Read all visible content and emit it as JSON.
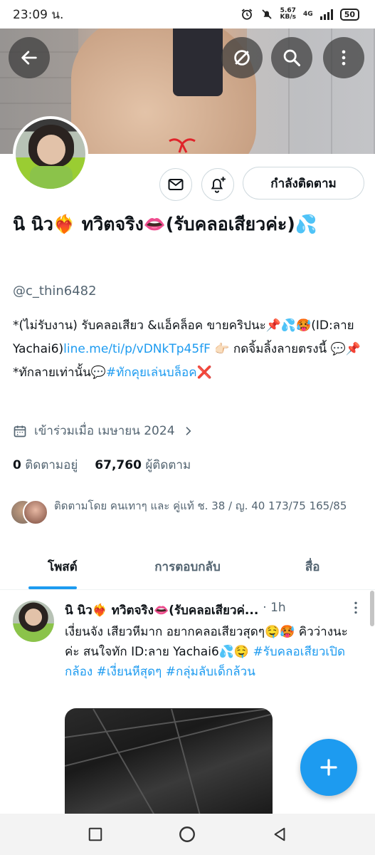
{
  "status_bar": {
    "time": "23:09 น.",
    "speed_value": "5.67",
    "speed_unit": "KB/s",
    "network": "4G",
    "battery": "50"
  },
  "header": {
    "back_icon": "back-arrow-icon",
    "icons": [
      "no-sync-icon",
      "search-icon",
      "more-vertical-icon"
    ]
  },
  "profile": {
    "name_text": "นิ นิว",
    "name_emoji": "❤️‍🔥",
    "name_rest": " ทวิตจริง👄(รับคลอเสียวค่ะ)💦",
    "handle": "@c_thin6482",
    "bio_part1": "*(ไม่รับงาน) รับคลอเสียว &แอ็คล็อค ขายคริปนะ📌💦🥵(ID:ลาย Yachai6)",
    "bio_link": "line.me/ti/p/vDNkTp45fF",
    "bio_part2": " 👉🏻 กดจิ้มลิ้งลายตรงนี้ 💬📌*ทักลายเท่านั้น💬",
    "bio_hashtag": "#ทักคุยเล่นบล็อค",
    "bio_end": "❌",
    "joined": "เข้าร่วมเมื่อ เมษายน 2024",
    "following_count": "0",
    "following_label": "ติดตามอยู่",
    "followers_count": "67,760",
    "followers_label": "ผู้ติดตาม",
    "followed_by": "ติดตามโดย คนเทาๆ และ คู่แท้ ช. 38 / ญ. 40 173/75 165/85",
    "follow_button": "กำลังติดตาม"
  },
  "tabs": [
    {
      "label": "โพสต์",
      "active": true
    },
    {
      "label": "การตอบกลับ",
      "active": false
    },
    {
      "label": "สื่อ",
      "active": false
    }
  ],
  "post": {
    "name": "นิ นิว❤️‍🔥 ทวิตจริง👄(รับคลอเสียวค่...",
    "time": "· 1h",
    "text": "เงี่ยนจัง เสียวหีมาก อยากคลอเสียวสุดๆ🤤🥵 คิวว่างนะค่ะ สนใจทัก ID:ลาย Yachai6💦🤤",
    "hashtags": "#รับคลอเสียวเปิดกล้อง #เงี่ยนหีสุดๆ #กลุ่มลับเด็กล้วน"
  },
  "colors": {
    "accent": "#1d9bf0",
    "text": "#0f1419",
    "muted": "#536471"
  }
}
